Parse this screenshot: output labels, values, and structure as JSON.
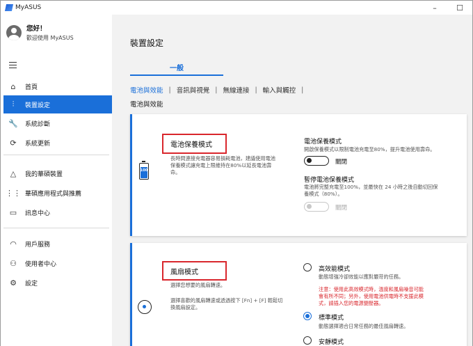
{
  "app": {
    "title": "MyASUS"
  },
  "window": {
    "minimize": "–",
    "maximize": "☐"
  },
  "profile": {
    "greeting": "您好！",
    "welcome": "歡迎使用 MyASUS"
  },
  "sidebar": {
    "items": [
      {
        "label": "首頁",
        "icon": "home-icon",
        "glyph": "⌂"
      },
      {
        "label": "裝置設定",
        "icon": "sliders-icon",
        "glyph": "⫶",
        "active": true
      },
      {
        "label": "系統診斷",
        "icon": "wrench-icon",
        "glyph": "🔧"
      },
      {
        "label": "系統更新",
        "icon": "update-icon",
        "glyph": "⟳"
      },
      {
        "label": "我的華碩裝置",
        "icon": "triangle-icon",
        "glyph": "△"
      },
      {
        "label": "華碩應用程式與推薦",
        "icon": "apps-grid-icon",
        "glyph": "⋮⋮"
      },
      {
        "label": "訊息中心",
        "icon": "message-icon",
        "glyph": "▭"
      },
      {
        "label": "用戶服務",
        "icon": "headset-icon",
        "glyph": "◠"
      },
      {
        "label": "使用者中心",
        "icon": "user-icon",
        "glyph": "⚇"
      },
      {
        "label": "設定",
        "icon": "gear-icon",
        "glyph": "⚙"
      }
    ]
  },
  "main": {
    "title": "裝置設定",
    "tab": "一般",
    "subtabs": [
      "電池與效能",
      "音訊與視覺",
      "無線連接",
      "輸入與觸控"
    ],
    "subtab_sep": "|",
    "section": "電池與效能"
  },
  "battery_card": {
    "title": "電池保養模式",
    "desc_lines": [
      "長時間連接充電器容易損耗電池，建議使用電池",
      "保養模式讓充電上限維持在80%以延長電池壽",
      "命。"
    ],
    "battery_text": "100",
    "option1": {
      "title": "電池保養模式",
      "desc": "開啟保養模式以限制電池充電至80%，提升電池使用壽命。",
      "toggle_label": "關閉"
    },
    "option2": {
      "title": "暫停電池保養模式",
      "desc_lines": [
        "電池將完整充電至100%，並最快在 24 小時之後自動切回保",
        "養模式（80%）。"
      ],
      "toggle_label": "關閉"
    }
  },
  "fan_card": {
    "title": "風扇模式",
    "desc1": "選擇您想要的風扇轉速。",
    "desc2_lines": [
      "選擇喜歡的風扇轉速或透過按下 [Fn] + [F] 輕鬆切",
      "換風扇設定。"
    ],
    "modes": [
      {
        "label": "高效能模式",
        "desc": "動態增強冷卻效能以應對嚴苛的任務。",
        "checked": false
      },
      {
        "label": "標準模式",
        "desc": "動態選擇適合日常任務的最佳風扇轉速。",
        "checked": true
      },
      {
        "label": "安靜模式",
        "desc": "",
        "checked": false
      }
    ],
    "warning_lines": [
      "注意：使用此高效模式時，溫度和風扇噪音可能",
      "會有所不同；另外，使用電池供電時不支援此模",
      "式，請插入您的電源變壓器。"
    ]
  }
}
